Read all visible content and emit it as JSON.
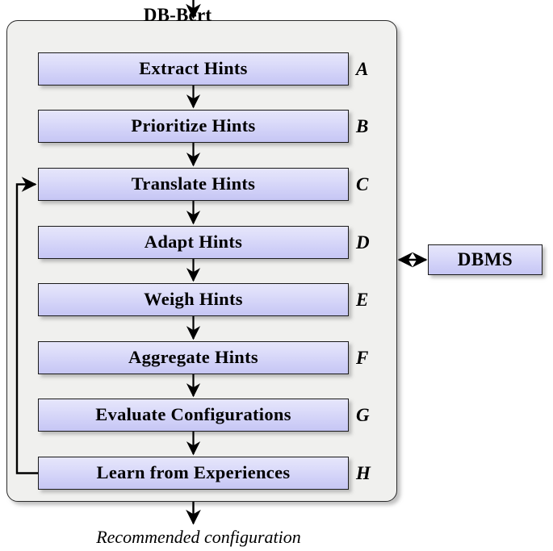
{
  "diagram": {
    "container_title": "DB-Bert",
    "bottom_caption": "Recommended configuration",
    "side_component": {
      "label": "DBMS"
    },
    "steps": [
      {
        "letter": "A",
        "label": "Extract Hints"
      },
      {
        "letter": "B",
        "label": "Prioritize Hints"
      },
      {
        "letter": "C",
        "label": "Translate Hints"
      },
      {
        "letter": "D",
        "label": "Adapt Hints"
      },
      {
        "letter": "E",
        "label": "Weigh Hints"
      },
      {
        "letter": "F",
        "label": "Aggregate Hints"
      },
      {
        "letter": "G",
        "label": "Evaluate Configurations"
      },
      {
        "letter": "H",
        "label": "Learn from Experiences"
      }
    ],
    "colors": {
      "box_fill_top": "#e6e6fb",
      "box_fill_bottom": "#c6c6f4",
      "box_border": "#1a1a1a",
      "container_fill": "#f0f0ee",
      "container_border": "#2b2b2b",
      "connector": "#000000",
      "page_background": "#ffffff"
    },
    "connectors": {
      "input_arrow": "vertical arrow into DB-Bert container from above",
      "output_arrow": "vertical arrow out of DB-Bert container to Recommended configuration",
      "dbms_link": "bidirectional horizontal arrow between DB-Bert and DBMS",
      "feedback_loop": "arrow from Learn from Experiences back to Translate Hints"
    }
  }
}
